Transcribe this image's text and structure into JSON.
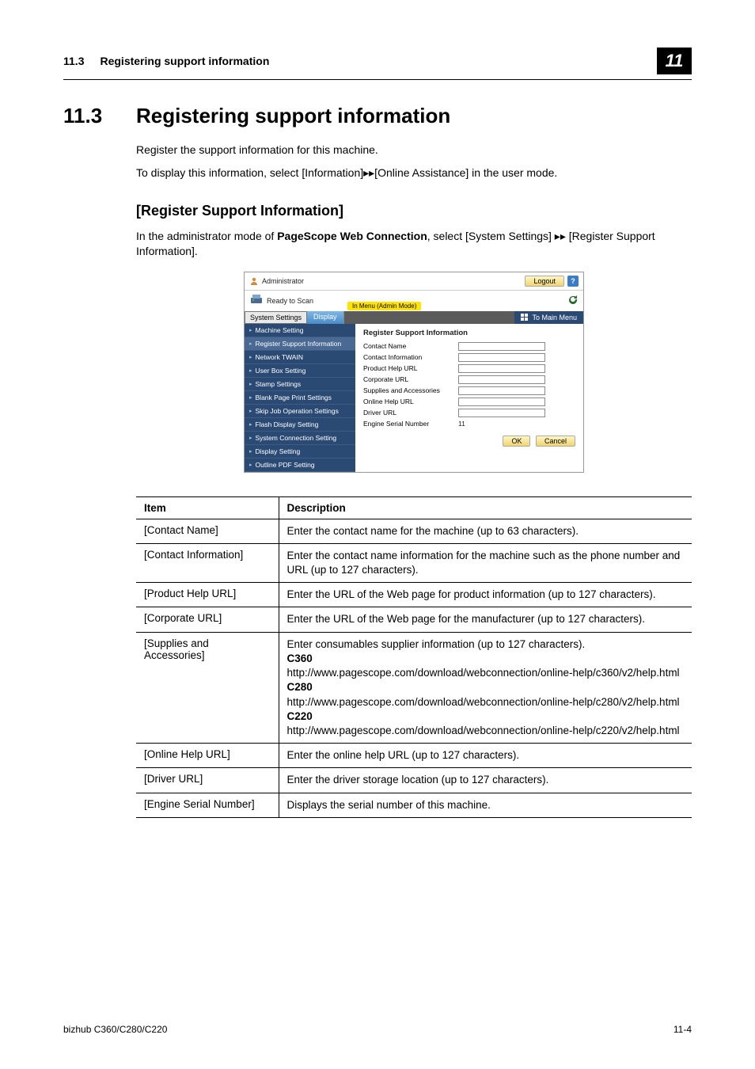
{
  "running_head": {
    "sec_no": "11.3",
    "sec_title": "Registering support information",
    "chap": "11"
  },
  "h1": {
    "num": "11.3",
    "text": "Registering support information"
  },
  "intro": {
    "p1": "Register the support information for this machine.",
    "p2": "To display this information, select [Information]▸▸[Online Assistance] in the user mode."
  },
  "sub_heading": "[Register Support Information]",
  "sub_intro_a": "In the administrator mode of ",
  "sub_intro_b": "PageScope Web Connection",
  "sub_intro_c": ", select [System Settings] ▸▸ [Register Support Information].",
  "shot": {
    "admin_label": "Administrator",
    "logout": "Logout",
    "help": "?",
    "ready": "Ready to Scan",
    "mode": "In Menu (Admin Mode)",
    "select": "System Settings",
    "display_btn": "Display",
    "mainmenu": "To Main Menu",
    "nav": [
      "Machine Setting",
      "Register Support Information",
      "Network TWAIN",
      "User Box Setting",
      "Stamp Settings",
      "Blank Page Print Settings",
      "Skip Job Operation Settings",
      "Flash Display Setting",
      "System Connection Setting",
      "Display Setting",
      "Outline PDF Setting"
    ],
    "form_title": "Register Support Information",
    "fields": [
      {
        "label": "Contact Name",
        "value": ""
      },
      {
        "label": "Contact Information",
        "value": ""
      },
      {
        "label": "Product Help URL",
        "value": ""
      },
      {
        "label": "Corporate URL",
        "value": ""
      },
      {
        "label": "Supplies and Accessories",
        "value": ""
      },
      {
        "label": "Online Help URL",
        "value": ""
      },
      {
        "label": "Driver URL",
        "value": ""
      }
    ],
    "serial_label": "Engine Serial Number",
    "serial_value": "11",
    "ok": "OK",
    "cancel": "Cancel"
  },
  "table": {
    "head_item": "Item",
    "head_desc": "Description",
    "rows": [
      {
        "item": "[Contact Name]",
        "desc": "Enter the contact name for the machine (up to 63 characters)."
      },
      {
        "item": "[Contact Information]",
        "desc": "Enter the contact name information for the machine such as the phone number and URL (up to 127 characters)."
      },
      {
        "item": "[Product Help URL]",
        "desc": "Enter the URL of the Web page for product information (up to 127 characters)."
      },
      {
        "item": "[Corporate URL]",
        "desc": "Enter the URL of the Web page for the manufacturer (up to 127 characters)."
      },
      {
        "item": "[Supplies and Accessories]",
        "desc": "Enter consumables supplier information (up to 127 characters).\nC360\nhttp://www.pagescope.com/download/webconnection/online-help/c360/v2/help.html\nC280\nhttp://www.pagescope.com/download/webconnection/online-help/c280/v2/help.html\nC220\nhttp://www.pagescope.com/download/webconnection/online-help/c220/v2/help.html"
      },
      {
        "item": "[Online Help URL]",
        "desc": "Enter the online help URL (up to 127 characters)."
      },
      {
        "item": "[Driver URL]",
        "desc": "Enter the driver storage location (up to 127 characters)."
      },
      {
        "item": "[Engine Serial Number]",
        "desc": "Displays the serial number of this machine."
      }
    ]
  },
  "footer": {
    "left": "bizhub C360/C280/C220",
    "right": "11-4"
  }
}
